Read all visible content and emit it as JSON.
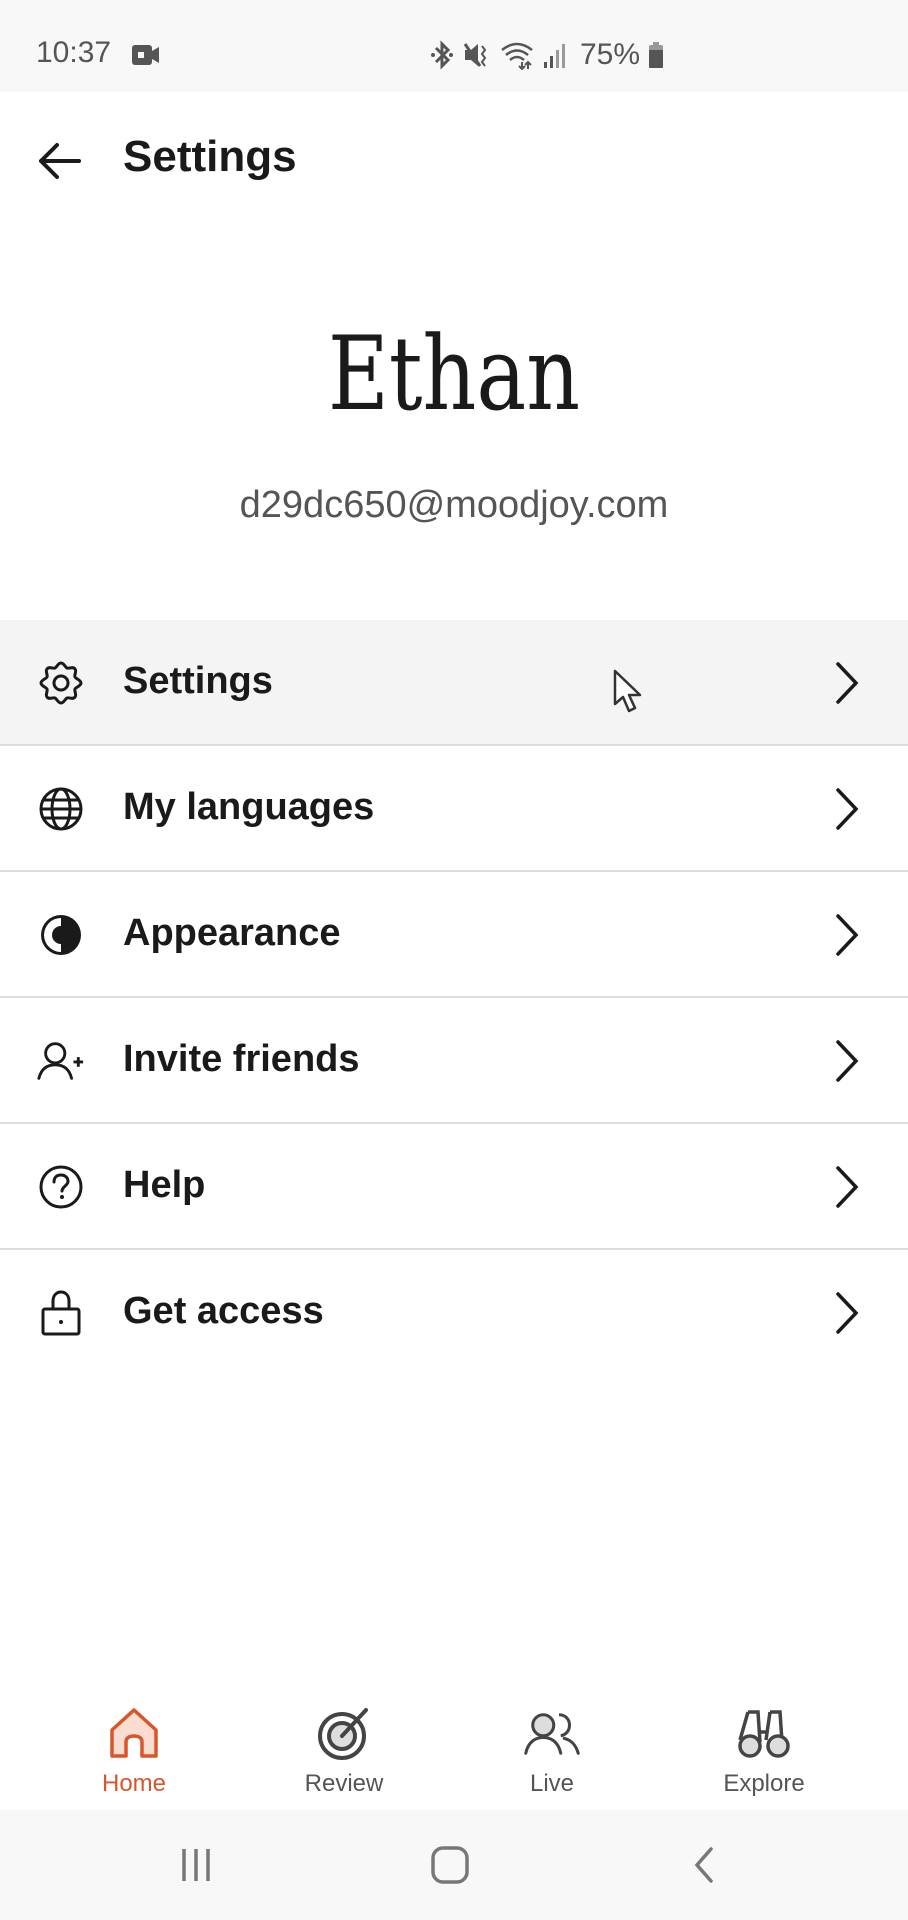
{
  "status_bar": {
    "time": "10:37",
    "battery": "75%",
    "icons": [
      "video-record-icon",
      "bluetooth-icon",
      "vibrate-mute-icon",
      "wifi-icon",
      "signal-icon",
      "battery-icon"
    ]
  },
  "header": {
    "back_icon": "arrow-left-icon",
    "title": "Settings"
  },
  "profile": {
    "name": "Ethan",
    "email": "d29dc650@moodjoy.com"
  },
  "menu": {
    "items": [
      {
        "label": "Settings",
        "icon": "gear-icon",
        "active": true
      },
      {
        "label": "My languages",
        "icon": "globe-icon",
        "active": false
      },
      {
        "label": "Appearance",
        "icon": "contrast-icon",
        "active": false
      },
      {
        "label": "Invite friends",
        "icon": "user-plus-icon",
        "active": false
      },
      {
        "label": "Help",
        "icon": "help-circle-icon",
        "active": false
      },
      {
        "label": "Get access",
        "icon": "lock-icon",
        "active": false
      }
    ]
  },
  "bottom_nav": {
    "accent_color": "#d9562a",
    "items": [
      {
        "label": "Home",
        "icon": "home-icon",
        "active": true
      },
      {
        "label": "Review",
        "icon": "target-icon",
        "active": false
      },
      {
        "label": "Live",
        "icon": "users-icon",
        "active": false
      },
      {
        "label": "Explore",
        "icon": "binoculars-icon",
        "active": false
      }
    ]
  },
  "system_nav": {
    "buttons": [
      "recent-apps",
      "home",
      "back"
    ]
  }
}
